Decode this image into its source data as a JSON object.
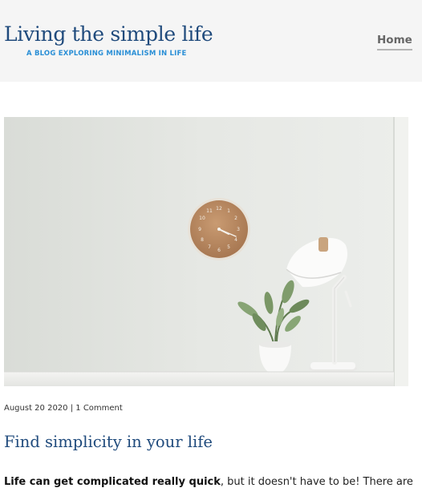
{
  "header": {
    "title": "Living the simple life",
    "tagline": "A BLOG EXPLORING MINIMALISM IN LIFE",
    "nav": {
      "home_label": "Home"
    }
  },
  "post": {
    "date": "August 20 2020",
    "separator": "|",
    "comments": "1 Comment",
    "title": "Find simplicity in your life",
    "excerpt_bold": "Life can get complicated really quick",
    "excerpt_rest": ", but it doesn't have to be! There are",
    "image": {
      "clock_numerals": [
        "12",
        "1",
        "2",
        "3",
        "4",
        "5",
        "6",
        "7",
        "8",
        "9",
        "10",
        "11"
      ]
    }
  },
  "colors": {
    "header_bg": "#f5f5f5",
    "title": "#1f4a7c",
    "tagline": "#2a8fd6",
    "wall": "#e4e6e2",
    "clock_face": "#b88a62"
  }
}
